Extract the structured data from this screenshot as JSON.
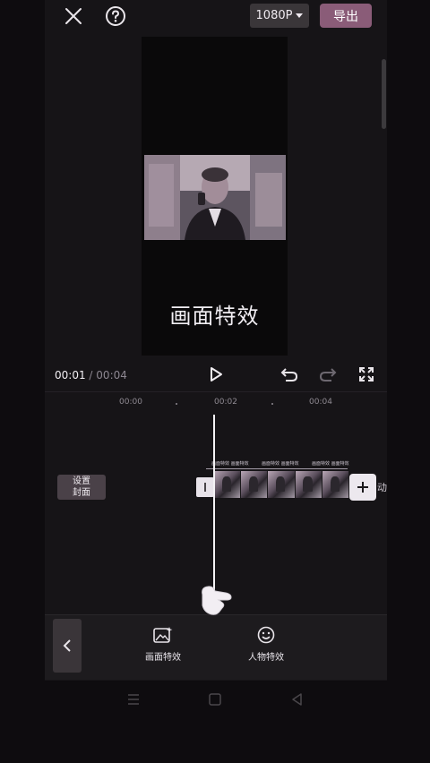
{
  "topbar": {
    "close_icon": "close-icon",
    "help_icon": "help-icon",
    "resolution": "1080P",
    "export_label": "导出"
  },
  "preview": {
    "overlay_text": "画面特效"
  },
  "playback": {
    "current_time": "00:01",
    "separator": "/",
    "total_time": "00:04",
    "play_icon": "play-icon",
    "undo_icon": "undo-icon",
    "redo_icon": "redo-icon",
    "fullscreen_icon": "fullscreen-icon"
  },
  "ruler": {
    "ticks": [
      "00:00",
      "00:02",
      "00:04"
    ]
  },
  "timeline": {
    "cover_line1": "设置",
    "cover_line2": "封面",
    "clip_header": [
      "画面特效 画面特效",
      "画面特效 画面特效",
      "画面特效 画面特效"
    ],
    "clip_label_peek": "动"
  },
  "toolbar": {
    "items": [
      {
        "label": "画面特效",
        "icon": "image-effect-icon"
      },
      {
        "label": "人物特效",
        "icon": "face-effect-icon"
      }
    ]
  },
  "colors": {
    "accent": "#8a5c78",
    "background": "#161417"
  }
}
